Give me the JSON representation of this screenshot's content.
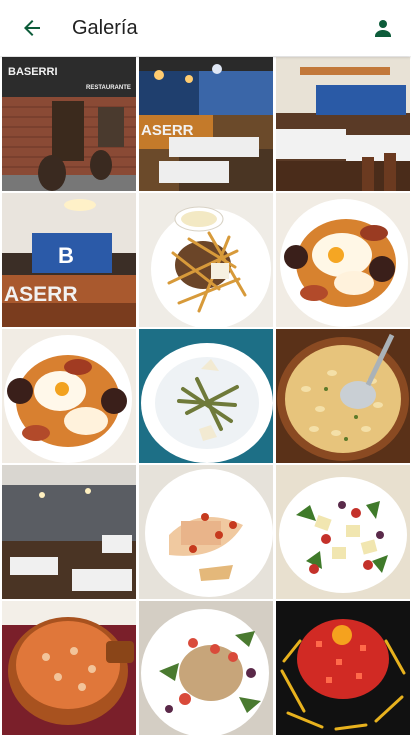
{
  "app_bar": {
    "title": "Galería",
    "back_icon": "arrow-back-icon",
    "profile_icon": "person-icon",
    "accent": "#0d5c3a"
  },
  "gallery": {
    "signs": {
      "facade": "BASERRI",
      "facade_sub": "RESTAURANTE",
      "interior": "ASERR",
      "bar": "ASERR"
    }
  }
}
